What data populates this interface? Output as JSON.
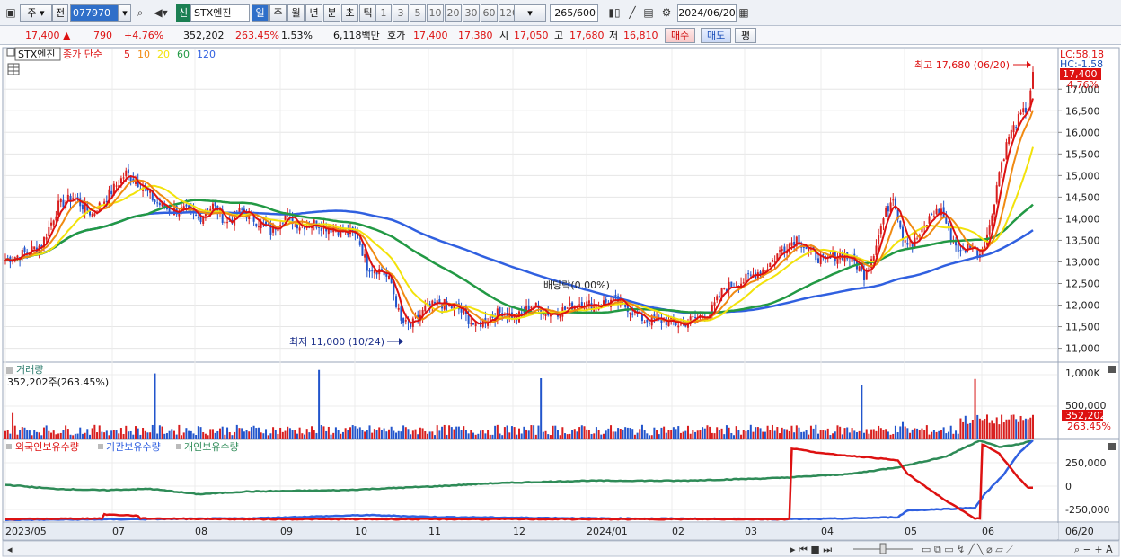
{
  "toolbar": {
    "market": "주",
    "prev": "전",
    "code": "077970",
    "new_badge": "신",
    "name": "STX엔진",
    "periods": [
      "일",
      "주",
      "월",
      "년",
      "분",
      "초",
      "틱"
    ],
    "active_period": "일",
    "intervals": [
      "1",
      "3",
      "5",
      "10",
      "20",
      "30",
      "60",
      "120"
    ],
    "count": "265",
    "count_max": "/600",
    "date": "2024/06/20"
  },
  "quote": {
    "price": "17,400",
    "change": "790",
    "change_pct": "+4.76%",
    "volume": "352,202",
    "volume_ratio": "263.45%",
    "turnover": "1.53%",
    "amount": "6,118백만",
    "bid_label": "호가",
    "ask": "17,400",
    "bid": "17,380",
    "open_label": "시",
    "open": "17,050",
    "high_label": "고",
    "high": "17,680",
    "low_label": "저",
    "low": "16,810",
    "buy_btn": "매수",
    "sell_btn": "매도",
    "eval_btn": "평"
  },
  "legend": {
    "stock": "STX엔진",
    "ma_label": "종가 단순",
    "ma": [
      {
        "label": "5",
        "color": "#dd1111"
      },
      {
        "label": "10",
        "color": "#f08a12"
      },
      {
        "label": "20",
        "color": "#f2e20a"
      },
      {
        "label": "60",
        "color": "#229944"
      },
      {
        "label": "120",
        "color": "#3060e0"
      }
    ]
  },
  "price_axis": {
    "ticks": [
      "17,000",
      "16,500",
      "16,000",
      "15,500",
      "15,000",
      "14,500",
      "14,000",
      "13,500",
      "13,000",
      "12,500",
      "12,000",
      "11,500",
      "11,000"
    ],
    "lc": "LC:58.18",
    "hc": "HC:-1.58",
    "last": "17,400",
    "last_pct": "4.76%"
  },
  "annotations": {
    "high": "최고 17,680 (06/20)",
    "low": "최저 11,000 (10/24)",
    "dividend": "배당락(0.00%)"
  },
  "volume_panel": {
    "title": "거래량",
    "value": "352,202주(263.45%)",
    "ticks": [
      "1,000K",
      "500,000"
    ],
    "last": "352,202",
    "last_pct": "263.45%"
  },
  "holding_panel": {
    "series": [
      {
        "name": "외국인보유수량",
        "color": "#dd1111"
      },
      {
        "name": "기관보유수량",
        "color": "#3060e0"
      },
      {
        "name": "개인보유수량",
        "color": "#2e8b57"
      }
    ],
    "ticks": [
      "250,000",
      "0",
      "-250,000"
    ]
  },
  "x_axis": {
    "labels": [
      "2023/05",
      "07",
      "08",
      "09",
      "10",
      "11",
      "12",
      "2024/01",
      "02",
      "03",
      "04",
      "05",
      "06"
    ],
    "end_label": "06/20"
  },
  "chart_data": {
    "type": "line",
    "title": "STX엔진 일봉",
    "y_range": [
      10700,
      17900
    ],
    "vol_range": [
      0,
      1100000
    ],
    "holding_range": [
      -300000,
      300000
    ],
    "price_knots": [
      [
        0,
        13050
      ],
      [
        8,
        13200
      ],
      [
        15,
        13400
      ],
      [
        22,
        14300
      ],
      [
        28,
        14500
      ],
      [
        36,
        14100
      ],
      [
        42,
        14500
      ],
      [
        50,
        15050
      ],
      [
        56,
        14800
      ],
      [
        62,
        14400
      ],
      [
        68,
        14200
      ],
      [
        74,
        14200
      ],
      [
        80,
        14000
      ],
      [
        86,
        14300
      ],
      [
        92,
        13900
      ],
      [
        98,
        14200
      ],
      [
        104,
        13950
      ],
      [
        110,
        13700
      ],
      [
        116,
        14100
      ],
      [
        122,
        13850
      ],
      [
        128,
        13900
      ],
      [
        134,
        13800
      ],
      [
        140,
        13700
      ],
      [
        146,
        13600
      ],
      [
        150,
        12900
      ],
      [
        156,
        12800
      ],
      [
        160,
        12500
      ],
      [
        164,
        11600
      ],
      [
        168,
        11500
      ],
      [
        174,
        11900
      ],
      [
        180,
        12050
      ],
      [
        188,
        11900
      ],
      [
        195,
        11500
      ],
      [
        200,
        11700
      ],
      [
        206,
        11850
      ],
      [
        212,
        11700
      ],
      [
        218,
        12000
      ],
      [
        226,
        11800
      ],
      [
        232,
        11900
      ],
      [
        238,
        12050
      ],
      [
        244,
        12000
      ],
      [
        252,
        12100
      ],
      [
        258,
        11950
      ],
      [
        265,
        11650
      ],
      [
        272,
        11650
      ],
      [
        280,
        11550
      ],
      [
        286,
        11700
      ],
      [
        292,
        11800
      ],
      [
        298,
        12400
      ],
      [
        304,
        12500
      ],
      [
        310,
        12700
      ],
      [
        316,
        12900
      ],
      [
        322,
        13300
      ],
      [
        328,
        13550
      ],
      [
        334,
        13200
      ],
      [
        340,
        13000
      ],
      [
        346,
        13200
      ],
      [
        352,
        13000
      ],
      [
        356,
        12700
      ],
      [
        360,
        13250
      ],
      [
        364,
        14000
      ],
      [
        368,
        14550
      ],
      [
        372,
        13600
      ],
      [
        376,
        13400
      ],
      [
        380,
        13700
      ],
      [
        384,
        14100
      ],
      [
        388,
        14200
      ],
      [
        392,
        13600
      ],
      [
        396,
        13200
      ],
      [
        400,
        13400
      ],
      [
        404,
        13200
      ],
      [
        408,
        13800
      ],
      [
        412,
        15100
      ],
      [
        416,
        15900
      ],
      [
        420,
        16300
      ],
      [
        424,
        16600
      ],
      [
        426,
        17400
      ]
    ],
    "volume_spikes": [
      [
        3,
        380000
      ],
      [
        62,
        950000
      ],
      [
        130,
        1000000
      ],
      [
        222,
        880000
      ],
      [
        322,
        170000
      ],
      [
        355,
        780000
      ],
      [
        372,
        250000
      ],
      [
        402,
        870000
      ],
      [
        410,
        230000
      ],
      [
        426,
        352202
      ]
    ],
    "foreign_knots": [
      [
        0,
        -285000
      ],
      [
        40,
        -280000
      ],
      [
        41,
        -250000
      ],
      [
        55,
        -260000
      ],
      [
        56,
        -280000
      ],
      [
        100,
        -285000
      ],
      [
        280,
        -285000
      ],
      [
        325,
        -285000
      ],
      [
        326,
        240000
      ],
      [
        340,
        200000
      ],
      [
        360,
        170000
      ],
      [
        370,
        150000
      ],
      [
        374,
        50000
      ],
      [
        390,
        -150000
      ],
      [
        402,
        -280000
      ],
      [
        404,
        -280000
      ],
      [
        405,
        270000
      ],
      [
        412,
        200000
      ],
      [
        420,
        20000
      ],
      [
        424,
        -50000
      ]
    ],
    "inst_knots": [
      [
        0,
        -290000
      ],
      [
        60,
        -285000
      ],
      [
        100,
        -280000
      ],
      [
        150,
        -255000
      ],
      [
        180,
        -270000
      ],
      [
        250,
        -280000
      ],
      [
        330,
        -285000
      ],
      [
        350,
        -280000
      ],
      [
        370,
        -270000
      ],
      [
        374,
        -220000
      ],
      [
        390,
        -210000
      ],
      [
        402,
        -200000
      ],
      [
        406,
        -100000
      ],
      [
        414,
        50000
      ],
      [
        420,
        200000
      ],
      [
        426,
        300000
      ]
    ],
    "indiv_knots": [
      [
        0,
        -30000
      ],
      [
        20,
        -60000
      ],
      [
        40,
        -70000
      ],
      [
        60,
        -60000
      ],
      [
        80,
        -100000
      ],
      [
        100,
        -80000
      ],
      [
        140,
        -70000
      ],
      [
        180,
        -40000
      ],
      [
        200,
        -20000
      ],
      [
        240,
        0
      ],
      [
        280,
        0
      ],
      [
        320,
        20000
      ],
      [
        350,
        50000
      ],
      [
        370,
        100000
      ],
      [
        390,
        180000
      ],
      [
        404,
        300000
      ],
      [
        412,
        250000
      ],
      [
        420,
        270000
      ],
      [
        426,
        300000
      ]
    ]
  }
}
